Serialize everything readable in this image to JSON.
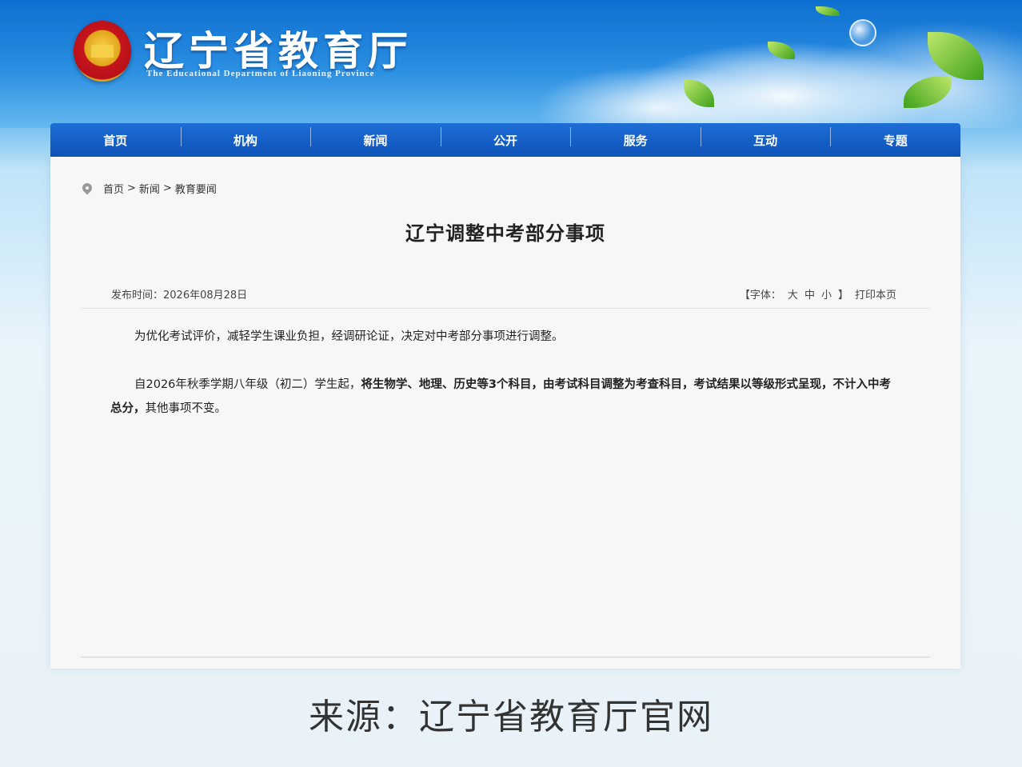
{
  "header": {
    "title": "辽宁省教育厅",
    "subtitle": "The Educational Department of Liaoning Province"
  },
  "nav": {
    "items": [
      "首页",
      "机构",
      "新闻",
      "公开",
      "服务",
      "互动",
      "专题"
    ]
  },
  "breadcrumb": {
    "items": [
      "首页",
      "新闻",
      "教育要闻"
    ],
    "separator": ">"
  },
  "article": {
    "title": "辽宁调整中考部分事项",
    "publish_time": "发布时间：2026年08月28日",
    "font_label": "【字体：",
    "font_large": "大",
    "font_medium": "中",
    "font_small": "小",
    "font_close": "】",
    "print_label": "打印本页",
    "para1": "为优化考试评价，减轻学生课业负担，经调研论证，决定对中考部分事项进行调整。",
    "para2_lead": "自2026年秋季学期八年级（初二）学生起，",
    "para2_bold": "将生物学、地理、历史等3个科目，由考试科目调整为考查科目，考试结果以等级形式呈现，不计入中考总分，",
    "para2_tail": "其他事项不变。"
  },
  "caption": "来源：辽宁省教育厅官网",
  "colors": {
    "nav_blue": "#0e52b8",
    "banner_blue": "#1a7fd6",
    "panel_bg": "#f7f7f7"
  }
}
